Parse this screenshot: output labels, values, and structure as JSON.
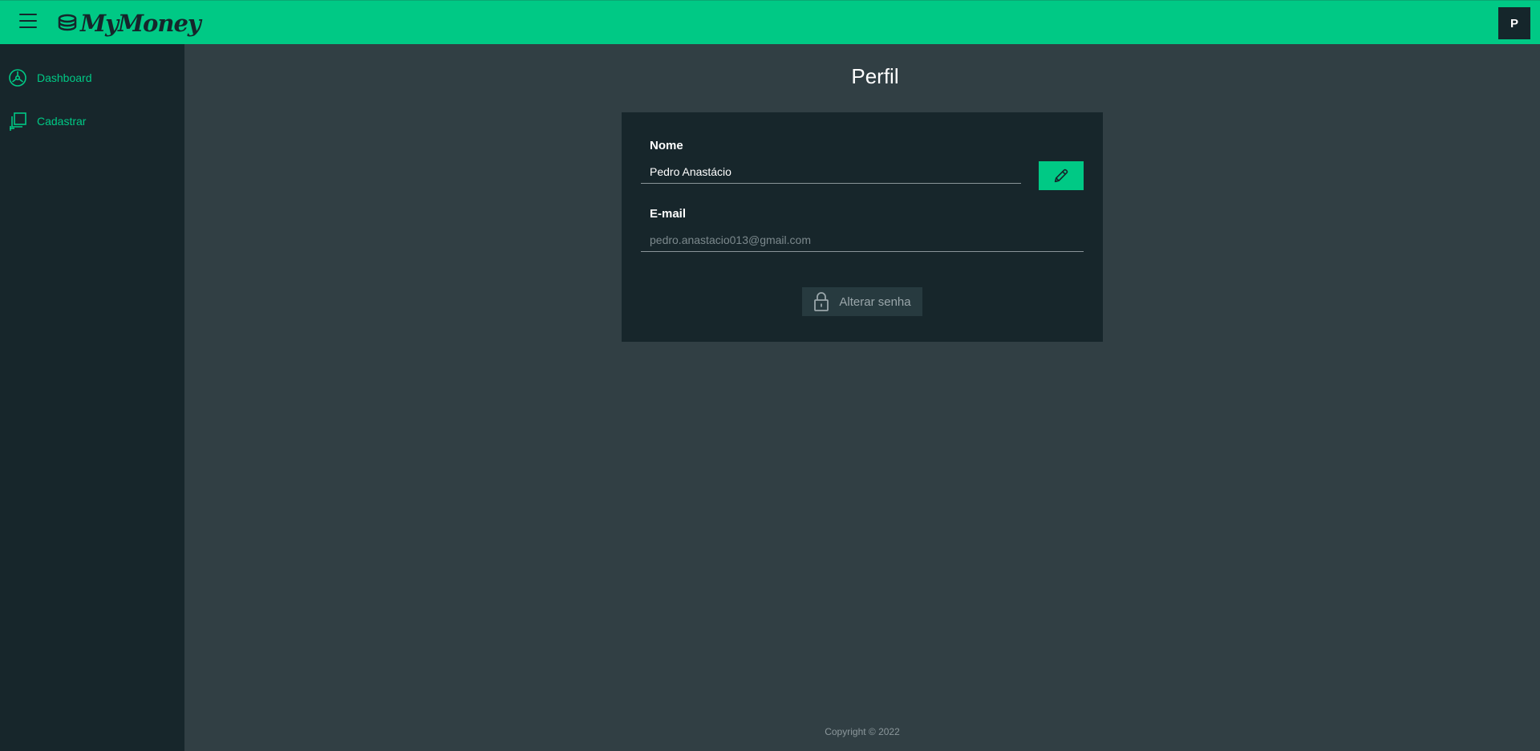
{
  "app": {
    "brand": "MyMoney",
    "avatar_initial": "P"
  },
  "sidebar": {
    "items": [
      {
        "label": "Dashboard",
        "icon": "dashboard-gauge-icon"
      },
      {
        "label": "Cadastrar",
        "icon": "add-copy-icon"
      }
    ]
  },
  "page": {
    "title": "Perfil"
  },
  "profile": {
    "name_label": "Nome",
    "name_value": "Pedro Anastácio",
    "email_label": "E-mail",
    "email_value": "pedro.anastacio013@gmail.com",
    "change_password_label": "Alterar senha"
  },
  "footer": {
    "copyright": "Copyright © 2022"
  },
  "colors": {
    "accent": "#00c985",
    "sidebar_bg": "#17262b",
    "main_bg": "#313f44",
    "card_bg": "#17262b"
  }
}
